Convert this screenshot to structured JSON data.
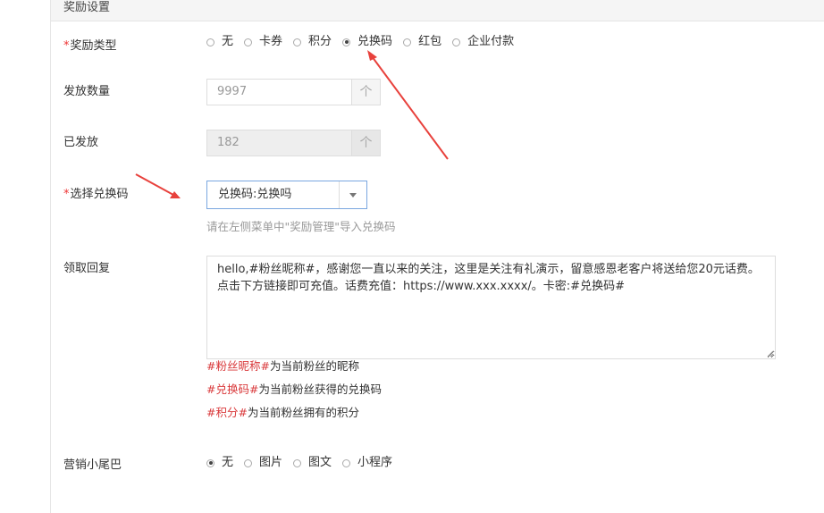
{
  "section": {
    "title": "奖励设置"
  },
  "reward_type": {
    "label": "奖励类型",
    "required_mark": "*",
    "options": [
      "无",
      "卡券",
      "积分",
      "兑换码",
      "红包",
      "企业付款"
    ],
    "selected": "兑换码"
  },
  "issue_quantity": {
    "label": "发放数量",
    "value": "9997",
    "spin_icon": "个"
  },
  "issued": {
    "label": "已发放",
    "value": "182",
    "spin_icon": "个"
  },
  "redeem_code": {
    "label": "选择兑换码",
    "required_mark": "*",
    "value": "兑换码:兑换吗",
    "hint": "请在左侧菜单中\"奖励管理\"导入兑换码"
  },
  "reply": {
    "label": "领取回复",
    "value": "hello,#粉丝昵称#，感谢您一直以来的关注，这里是关注有礼演示，留意感恩老客户将送给您20元话费。点击下方链接即可充值。话费充值：https://www.xxx.xxxx/。卡密:#兑换码#",
    "variables": [
      {
        "tag": "#粉丝昵称#",
        "desc": "为当前粉丝的昵称"
      },
      {
        "tag": "#兑换码#",
        "desc": "为当前粉丝获得的兑换码"
      },
      {
        "tag": "#积分#",
        "desc": "为当前粉丝拥有的积分"
      }
    ]
  },
  "tail": {
    "label": "营销小尾巴",
    "options": [
      "无",
      "图片",
      "图文",
      "小程序"
    ],
    "selected": "无"
  },
  "colors": {
    "annotation_arrow": "#e8413c",
    "variable_tag": "#d9383a",
    "required": "#e33333"
  }
}
